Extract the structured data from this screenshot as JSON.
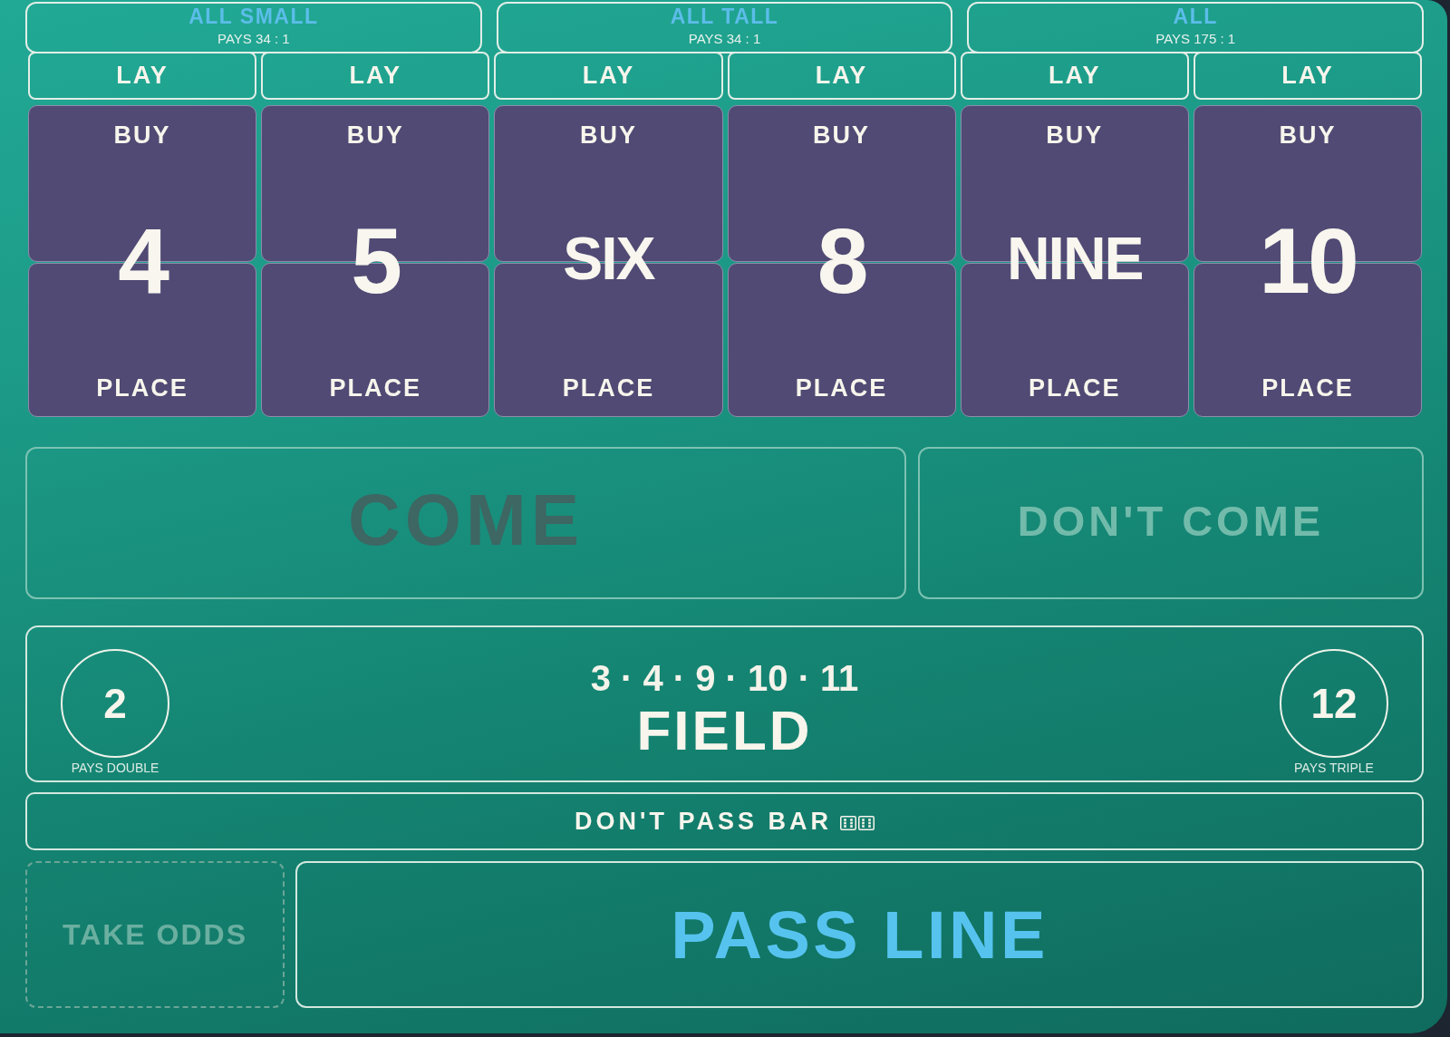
{
  "all_bets": [
    {
      "label": "ALL SMALL",
      "payout": "PAYS 34 : 1"
    },
    {
      "label": "ALL TALL",
      "payout": "PAYS 34 : 1"
    },
    {
      "label": "ALL",
      "payout": "PAYS 175 : 1"
    }
  ],
  "numbers": [
    {
      "lay": "LAY",
      "buy": "BUY",
      "number": "4",
      "kind": "digit",
      "place": "PLACE"
    },
    {
      "lay": "LAY",
      "buy": "BUY",
      "number": "5",
      "kind": "digit",
      "place": "PLACE"
    },
    {
      "lay": "LAY",
      "buy": "BUY",
      "number": "SIX",
      "kind": "word",
      "place": "PLACE"
    },
    {
      "lay": "LAY",
      "buy": "BUY",
      "number": "8",
      "kind": "digit",
      "place": "PLACE"
    },
    {
      "lay": "LAY",
      "buy": "BUY",
      "number": "NINE",
      "kind": "word",
      "place": "PLACE"
    },
    {
      "lay": "LAY",
      "buy": "BUY",
      "number": "10",
      "kind": "digit",
      "place": "PLACE"
    }
  ],
  "come": {
    "label": "COME"
  },
  "dont_come": {
    "label": "DON'T COME"
  },
  "field": {
    "numbers": "3 · 4 · 9 · 10 · 11",
    "label": "FIELD",
    "specials": [
      {
        "number": "2",
        "payout": "PAYS DOUBLE"
      },
      {
        "number": "12",
        "payout": "PAYS TRIPLE"
      }
    ]
  },
  "dont_pass_bar": {
    "label": "DON'T PASS BAR"
  },
  "take_odds": {
    "label": "TAKE ODDS"
  },
  "pass_line": {
    "label": "PASS LINE"
  }
}
